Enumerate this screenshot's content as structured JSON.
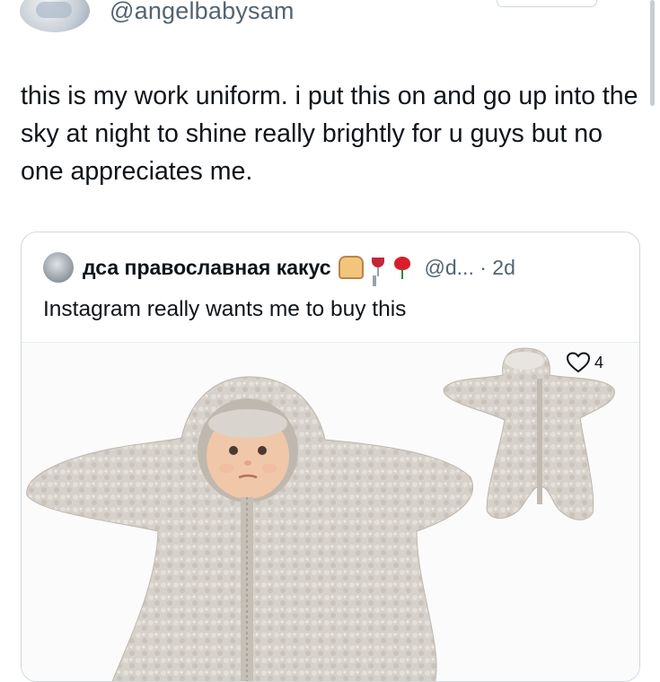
{
  "tweet": {
    "handle": "@angelbabysam",
    "text": "this is my work uniform. i put this on and go up into the sky at night to shine really brightly for u guys but no one appreciates me."
  },
  "quote": {
    "display_name": "дса православная какус",
    "name_emojis": [
      "bread-emoji",
      "wine-glass-emoji",
      "rose-emoji"
    ],
    "handle_time": "@d... · 2d",
    "text": "Instagram really wants me to buy this",
    "media": {
      "description_icon": "star-baby-sleepsuit-image",
      "like_count": "4"
    }
  },
  "colors": {
    "text": "#0f1419",
    "secondary": "#536471",
    "border": "#cfd9de",
    "fleece": "#d6d1ca"
  }
}
